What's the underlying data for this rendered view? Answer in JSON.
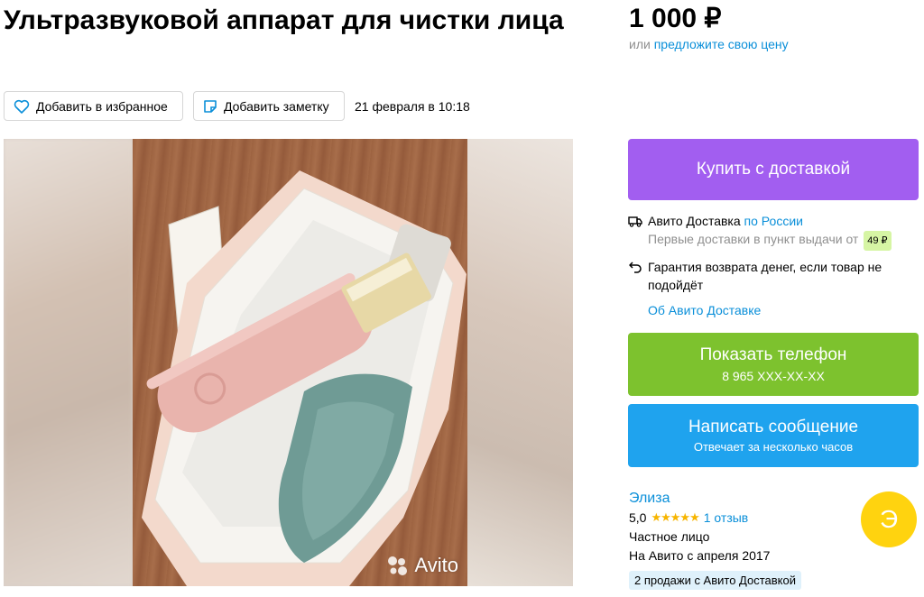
{
  "listing": {
    "title": "Ультразвуковой аппарат для чистки лица",
    "price": "1 000 ₽",
    "price_alt_prefix": "или",
    "price_alt_link": "предложите свою цену",
    "favorite_label": "Добавить в избранное",
    "note_label": "Добавить заметку",
    "date": "21 февраля в 10:18"
  },
  "gallery": {
    "watermark": "Avito"
  },
  "buy": {
    "label": "Купить с доставкой"
  },
  "delivery": {
    "service": "Авито Доставка",
    "scope_link": "по России",
    "first_delivery": "Первые доставки в пункт выдачи от",
    "first_price": "49 ₽",
    "guarantee": "Гарантия возврата денег, если товар не подойдёт",
    "about_link": "Об Авито Доставке"
  },
  "contact": {
    "phone_label": "Показать телефон",
    "phone_masked": "8 965 XXX-XX-XX",
    "message_label": "Написать сообщение",
    "message_sub": "Отвечает за несколько часов"
  },
  "seller": {
    "name": "Элиза",
    "rating": "5,0",
    "stars": "★★★★★",
    "reviews": "1 отзыв",
    "type": "Частное лицо",
    "since": "На Авито с апреля 2017",
    "sales_badge": "2 продажи с Авито Доставкой",
    "avatar_letter": "Э"
  },
  "colors": {
    "buy": "#a25ef0",
    "phone": "#7dc22e",
    "message": "#1fa3ee",
    "link": "#0a8fd9",
    "avatar": "#ffd30f"
  }
}
